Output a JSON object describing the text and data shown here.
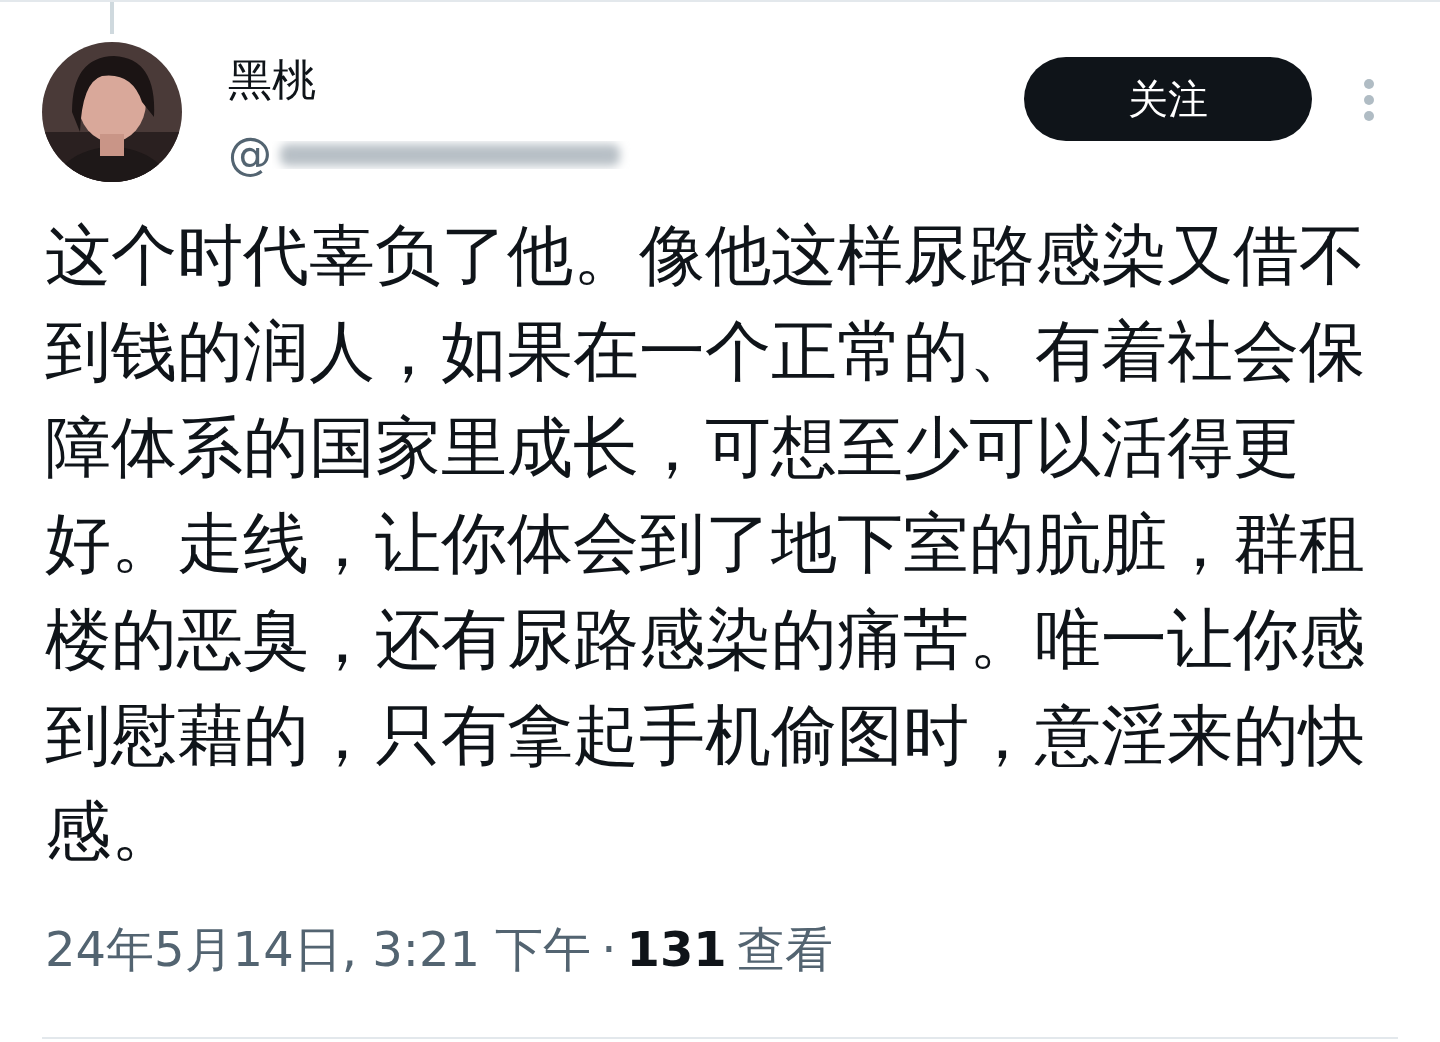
{
  "author": {
    "name": "黑桃",
    "handle": "@"
  },
  "follow_button": {
    "label": "关注"
  },
  "tweet_text": "这个时代辜负了他。像他这样尿路感染又借不到钱的润人，如果在一个正常的、有着社会保障体系的国家里成长，可想至少可以活得更好。走线，让你体会到了地下室的肮脏，群租楼的恶臭，还有尿路感染的痛苦。唯一让你感到慰藉的，只有拿起手机偷图时，意淫来的快感。",
  "meta": {
    "timestamp": "24年5月14日, 3:21 下午",
    "separator": "·",
    "views_count": "131",
    "views_label": "查看"
  }
}
